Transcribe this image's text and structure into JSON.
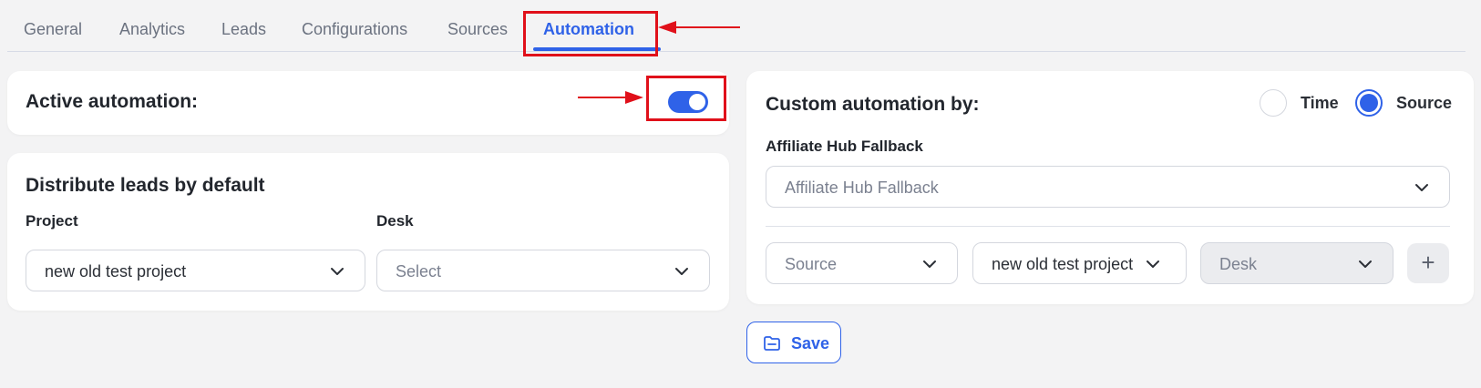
{
  "tabs": [
    "General",
    "Analytics",
    "Leads",
    "Configurations",
    "Sources",
    "Automation"
  ],
  "active_tab": "Automation",
  "active_automation": {
    "label": "Active automation:",
    "enabled": true
  },
  "distribute": {
    "title": "Distribute leads by default",
    "project_label": "Project",
    "project_value": "new old test project",
    "desk_label": "Desk",
    "desk_placeholder": "Select"
  },
  "custom": {
    "title": "Custom automation by:",
    "options": [
      "Time",
      "Source"
    ],
    "selected": "Source",
    "fallback_label": "Affiliate Hub Fallback",
    "fallback_placeholder": "Affiliate Hub Fallback",
    "row": {
      "source_placeholder": "Source",
      "project_value": "new old test project",
      "desk_placeholder": "Desk",
      "add_label": "+"
    }
  },
  "save_label": "Save",
  "colors": {
    "accent": "#2f62e8",
    "annotation": "#e0101a",
    "background": "#f3f3f4"
  }
}
